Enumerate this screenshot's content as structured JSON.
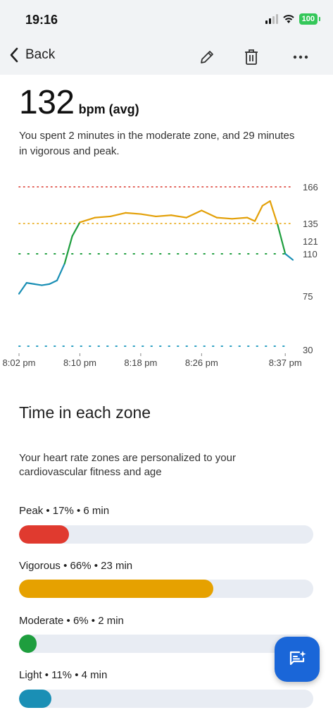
{
  "status": {
    "time": "19:16",
    "battery": "100"
  },
  "nav": {
    "back_label": "Back",
    "icons": [
      "edit-icon",
      "delete-icon",
      "more-icon"
    ]
  },
  "summary": {
    "avg_number": "132",
    "avg_unit": "bpm (avg)",
    "text": "You spent 2 minutes in the moderate zone, and 29 minutes in vigorous and peak."
  },
  "chart_data": {
    "type": "line",
    "title": "",
    "xlabel": "",
    "ylabel": "",
    "x_tick_labels": [
      "8:02 pm",
      "8:10 pm",
      "8:18 pm",
      "8:26 pm",
      "8:37 pm"
    ],
    "y_tick_labels": [
      "166",
      "135",
      "121",
      "110",
      "75",
      "30"
    ],
    "thresholds": [
      {
        "value": 166,
        "color": "#d93025"
      },
      {
        "value": 135,
        "color": "#e6a100"
      },
      {
        "value": 110,
        "color": "#1e9e3e"
      }
    ],
    "series": [
      {
        "x": [
          "8:02 pm",
          "8:03 pm",
          "8:04 pm",
          "8:05 pm",
          "8:06 pm",
          "8:07 pm",
          "8:08 pm",
          "8:09 pm",
          "8:10 pm",
          "8:12 pm",
          "8:14 pm",
          "8:16 pm",
          "8:18 pm",
          "8:20 pm",
          "8:22 pm",
          "8:24 pm",
          "8:26 pm",
          "8:28 pm",
          "8:30 pm",
          "8:32 pm",
          "8:33 pm",
          "8:34 pm",
          "8:35 pm",
          "8:36 pm",
          "8:37 pm",
          "8:38 pm"
        ],
        "values": [
          77,
          86,
          85,
          84,
          85,
          88,
          102,
          125,
          136,
          140,
          141,
          144,
          143,
          141,
          142,
          140,
          146,
          140,
          139,
          140,
          137,
          150,
          154,
          134,
          110,
          105
        ]
      }
    ],
    "zone_colors": {
      "peak": "#d93025",
      "vigorous": "#e3a008",
      "moderate": "#1e9e3e",
      "light": "#1a8fb5"
    }
  },
  "zones_section": {
    "title": "Time in each zone",
    "description": "Your heart rate zones are personalized to your cardiovascular fitness and age"
  },
  "zones": [
    {
      "label": "Peak • 17% • 6 min",
      "percent": 17,
      "color": "#e03a2f"
    },
    {
      "label": "Vigorous • 66% • 23 min",
      "percent": 66,
      "color": "#e6a100"
    },
    {
      "label": "Moderate • 6% • 2 min",
      "percent": 6,
      "color": "#1e9e3e"
    },
    {
      "label": "Light • 11% • 4 min",
      "percent": 11,
      "color": "#1a8fb5"
    }
  ]
}
